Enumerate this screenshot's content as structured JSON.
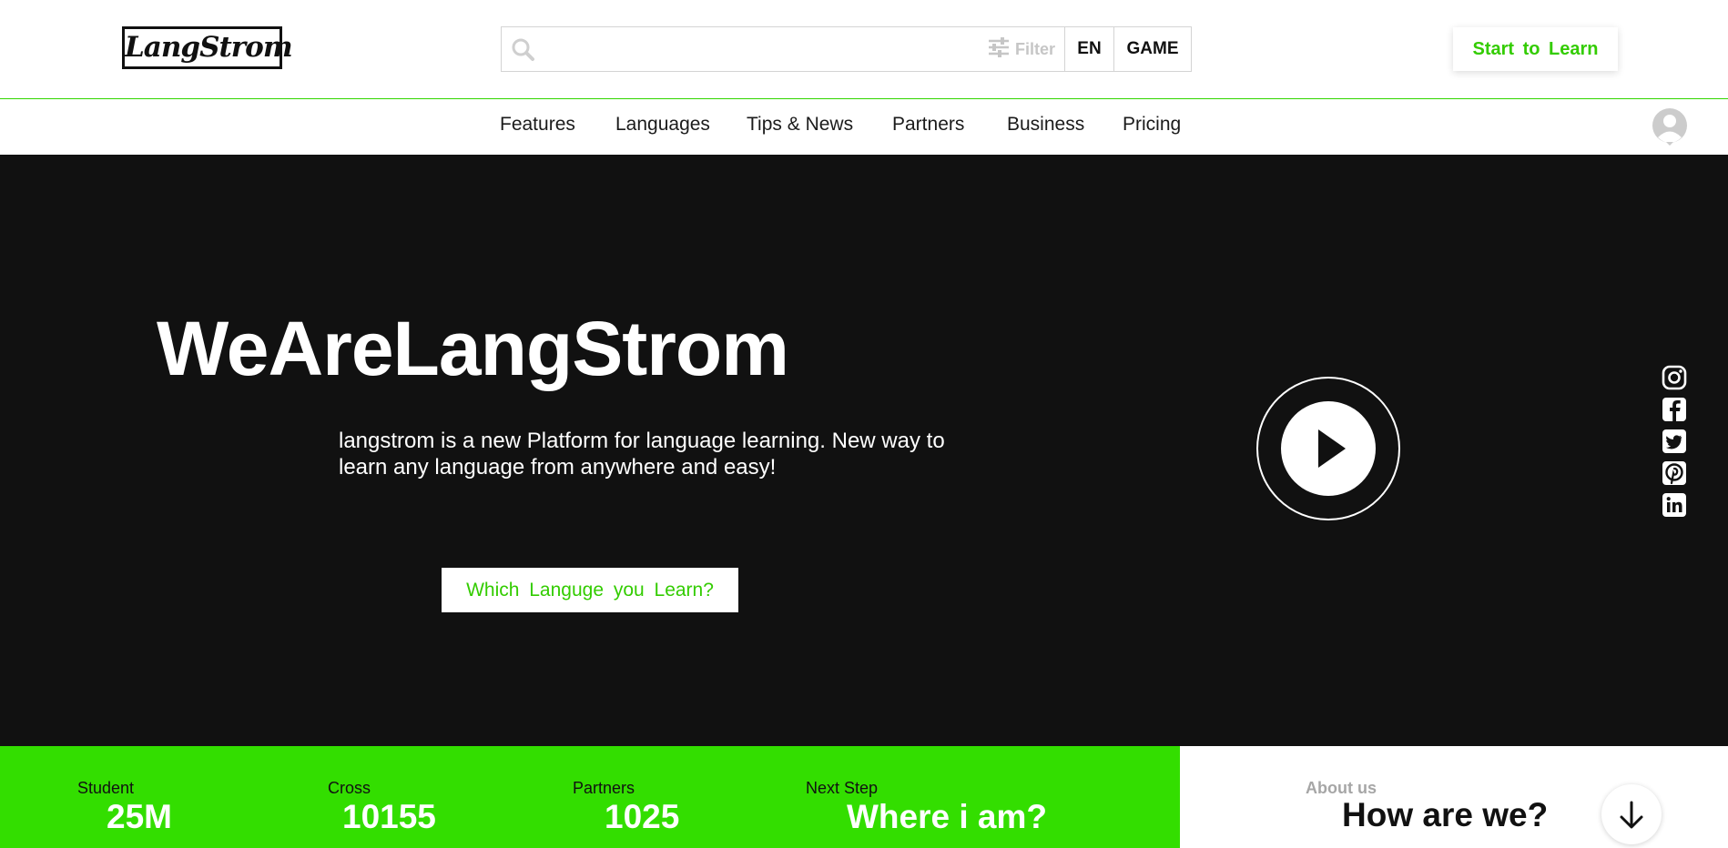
{
  "header": {
    "logo_text": "LangStrom",
    "search": {
      "placeholder": "",
      "value": ""
    },
    "filter_label": "Filter",
    "language_label": "EN",
    "game_label": "GAME",
    "start_button": "Start to Learn"
  },
  "nav": {
    "items": [
      "Features",
      "Languages",
      "Tips & News",
      "Partners",
      "Business",
      "Pricing"
    ]
  },
  "hero": {
    "title": "WeAreLangStrom",
    "description": "langstrom is a new Platform for language learning. New way to learn any language from anywhere and easy!",
    "cta_button": "Which Languge you Learn?"
  },
  "social": [
    "instagram-icon",
    "facebook-icon",
    "twitter-icon",
    "pinterest-icon",
    "linkedin-icon"
  ],
  "stats": [
    {
      "label": "Student",
      "value": "25M"
    },
    {
      "label": "Cross",
      "value": "10155"
    },
    {
      "label": "Partners",
      "value": "1025"
    },
    {
      "label": "Next Step",
      "value": "Where i am?"
    }
  ],
  "about": {
    "label": "About us",
    "title": "How are we?"
  },
  "colors": {
    "accent": "#33de00",
    "accent_text": "#33cc00",
    "hero_background": "#111111"
  }
}
